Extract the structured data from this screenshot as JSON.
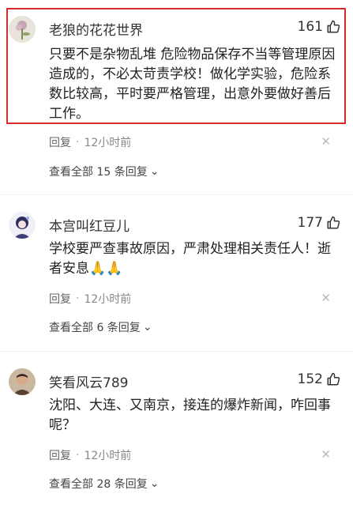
{
  "comments": [
    {
      "username": "老狼的花花世界",
      "likes": "161",
      "content": "只要不是杂物乱堆 危险物品保存不当等管理原因造成的，不必太苛责学校！做化学实验，危险系数比较高，平时要严格管理，出意外要做好善后工作。",
      "reply_label": "回复",
      "time": "12小时前",
      "view_all": "查看全部 15 条回复",
      "avatar_icon": "flower-avatar"
    },
    {
      "username": "本宫叫红豆儿",
      "likes": "177",
      "content": "学校要严查事故原因，严肃处理相关责任人！逝者安息🙏🙏",
      "reply_label": "回复",
      "time": "12小时前",
      "view_all": "查看全部 6 条回复",
      "avatar_icon": "anime-avatar"
    },
    {
      "username": "笑看风云789",
      "likes": "152",
      "content": "沈阳、大连、又南京，接连的爆炸新闻，咋回事呢？",
      "reply_label": "回复",
      "time": "12小时前",
      "view_all": "查看全部 28 条回复",
      "avatar_icon": "person-avatar"
    }
  ],
  "colors": {
    "highlight": "#d62b2b",
    "meta": "#888888"
  }
}
